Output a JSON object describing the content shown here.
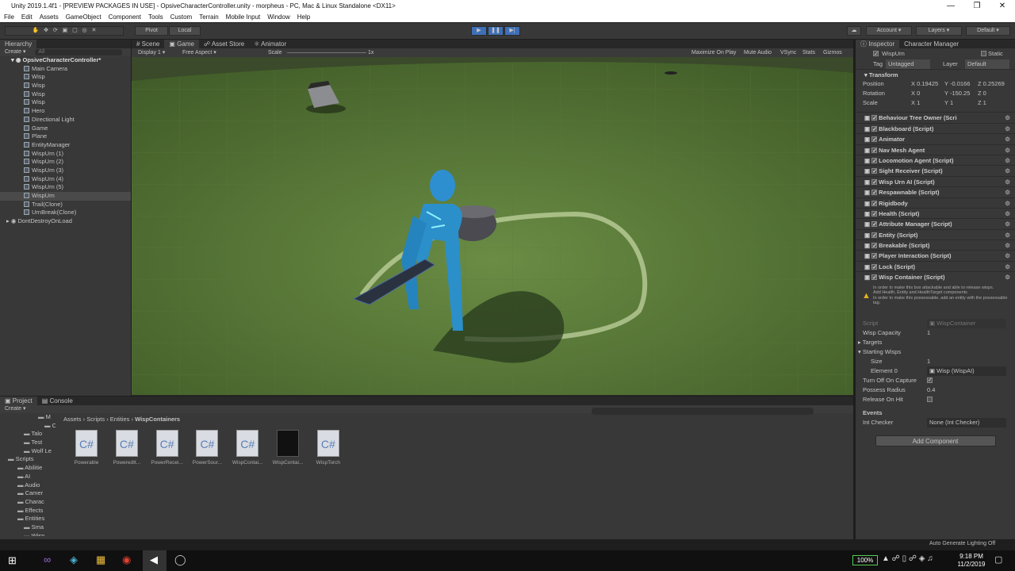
{
  "window": {
    "title": "Unity 2019.1.4f1 - [PREVIEW PACKAGES IN USE] - OpsiveCharacterController.unity - morpheus - PC, Mac & Linux Standalone <DX11>"
  },
  "menu": [
    "File",
    "Edit",
    "Assets",
    "GameObject",
    "Component",
    "Tools",
    "Custom",
    "Terrain",
    "Mobile Input",
    "Window",
    "Help"
  ],
  "toolbar": {
    "pivot": "Pivot",
    "local": "Local",
    "account": "Account",
    "layers": "Layers",
    "layout": "Default"
  },
  "hierarchy": {
    "tab": "Hierarchy",
    "create": "Create",
    "search_placeholder": "All",
    "scene": "OpsiveCharacterController*",
    "items": [
      "Main Camera",
      "Wisp",
      "Wisp",
      "Wisp",
      "Wisp",
      "Hero",
      "Directional Light",
      "Game",
      "Plane",
      "EntityManager",
      "WispUrn (1)",
      "WispUrn (2)",
      "WispUrn (3)",
      "WispUrn (4)",
      "WispUrn (5)",
      "WispUrn",
      "Trail(Clone)",
      "UrnBreak(Clone)"
    ],
    "dont_destroy": "DontDestroyOnLoad"
  },
  "scene_view": {
    "tabs": [
      "Scene",
      "Game",
      "Asset Store",
      "Animator"
    ],
    "display": "Display 1",
    "aspect": "Free Aspect",
    "scale_label": "Scale",
    "scale_value": "1x",
    "options": [
      "Maximize On Play",
      "Mute Audio",
      "VSync",
      "Stats",
      "Gizmos"
    ]
  },
  "inspector": {
    "tabs": [
      "Inspector",
      "Character Manager"
    ],
    "object_name": "WispUrn",
    "static": "Static",
    "tag_label": "Tag",
    "tag": "Untagged",
    "layer_label": "Layer",
    "layer": "Default",
    "transform": {
      "title": "Transform",
      "position": {
        "label": "Position",
        "x": "0.19425",
        "y": "-0.0166",
        "z": "0.25269"
      },
      "rotation": {
        "label": "Rotation",
        "x": "0",
        "y": "-150.25",
        "z": "0"
      },
      "scale": {
        "label": "Scale",
        "x": "1",
        "y": "1",
        "z": "1"
      }
    },
    "components": [
      "Behaviour Tree Owner (Scri",
      "Blackboard (Script)",
      "Animator",
      "Nav Mesh Agent",
      "Locomotion Agent (Script)",
      "Sight Receiver (Script)",
      "Wisp Urn AI (Script)",
      "Respawnable (Script)",
      "Rigidbody",
      "Health (Script)",
      "Attribute Manager (Script)",
      "Entity (Script)",
      "Breakable (Script)",
      "Player Interaction (Script)",
      "Lock (Script)",
      "Wisp Container (Script)"
    ],
    "warning": [
      "In order to make this box attackable and able to release wisps.",
      "Add Health, Entity and HealthTarget components",
      "In order to make this possessable, add an entity with the possessable tag."
    ],
    "fields": {
      "script_label": "Script",
      "script_value": "WispContainer",
      "capacity_label": "Wisp Capacity",
      "capacity_value": "1",
      "targets_label": "Targets",
      "starting_label": "Starting Wisps",
      "size_label": "Size",
      "size_value": "1",
      "element_label": "Element 0",
      "element_value": "Wisp (WispAI)",
      "turnoff_label": "Turn Off On Capture",
      "radius_label": "Possess Radius",
      "radius_value": "0.4",
      "release_label": "Release On Hit",
      "events_label": "Events",
      "int_label": "Int Checker",
      "int_value": "None (Int Checker)"
    },
    "add_component": "Add Component"
  },
  "project": {
    "tabs": [
      "Project",
      "Console"
    ],
    "create": "Create",
    "breadcrumb": [
      "Assets",
      "Scripts",
      "Entities",
      "WispContainers"
    ],
    "folders": [
      "M",
      "O",
      "Talo",
      "Test",
      "Wolf Le",
      "Scripts",
      "Abilitie",
      "AI",
      "Audio",
      "Camer",
      "Charac",
      "Effects",
      "Entities",
      "Sma",
      "Wisp"
    ],
    "assets": [
      {
        "name": "Powerable",
        "icon": "C#"
      },
      {
        "name": "PoweredIt...",
        "icon": "C#"
      },
      {
        "name": "PowerRecei...",
        "icon": "C#"
      },
      {
        "name": "PowerSour...",
        "icon": "C#"
      },
      {
        "name": "WispContai...",
        "icon": "C#"
      },
      {
        "name": "WispContai...",
        "icon": "prefab"
      },
      {
        "name": "WispTorch",
        "icon": "C#"
      }
    ]
  },
  "status": "Auto Generate Lighting Off",
  "taskbar": {
    "battery": "100%",
    "time": "9:18 PM",
    "date": "11/2/2019"
  }
}
